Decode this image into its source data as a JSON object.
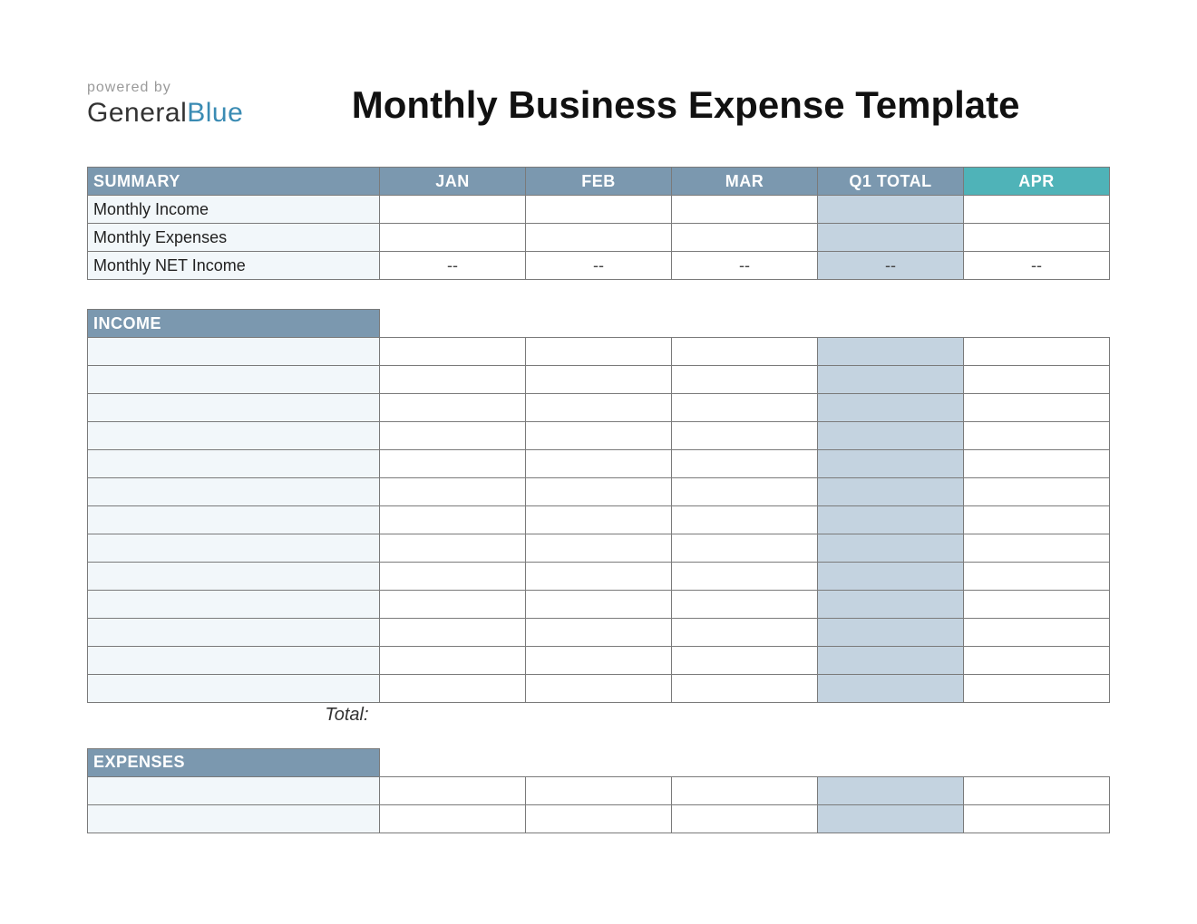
{
  "brand": {
    "powered": "powered by",
    "name1": "General",
    "name2": "Blue"
  },
  "title": "Monthly Business Expense Template",
  "columns": {
    "c0": "SUMMARY",
    "c1": "JAN",
    "c2": "FEB",
    "c3": "MAR",
    "c4": "Q1 TOTAL",
    "c5": "APR"
  },
  "summary": {
    "r0": {
      "label": "Monthly Income",
      "jan": "",
      "feb": "",
      "mar": "",
      "q1": "",
      "apr": ""
    },
    "r1": {
      "label": "Monthly Expenses",
      "jan": "",
      "feb": "",
      "mar": "",
      "q1": "",
      "apr": ""
    },
    "r2": {
      "label": "Monthly NET Income",
      "jan": "--",
      "feb": "--",
      "mar": "--",
      "q1": "--",
      "apr": "--"
    }
  },
  "income": {
    "header": "INCOME",
    "total_label": "Total:",
    "rows": [
      {
        "label": "",
        "jan": "",
        "feb": "",
        "mar": "",
        "q1": "",
        "apr": ""
      },
      {
        "label": "",
        "jan": "",
        "feb": "",
        "mar": "",
        "q1": "",
        "apr": ""
      },
      {
        "label": "",
        "jan": "",
        "feb": "",
        "mar": "",
        "q1": "",
        "apr": ""
      },
      {
        "label": "",
        "jan": "",
        "feb": "",
        "mar": "",
        "q1": "",
        "apr": ""
      },
      {
        "label": "",
        "jan": "",
        "feb": "",
        "mar": "",
        "q1": "",
        "apr": ""
      },
      {
        "label": "",
        "jan": "",
        "feb": "",
        "mar": "",
        "q1": "",
        "apr": ""
      },
      {
        "label": "",
        "jan": "",
        "feb": "",
        "mar": "",
        "q1": "",
        "apr": ""
      },
      {
        "label": "",
        "jan": "",
        "feb": "",
        "mar": "",
        "q1": "",
        "apr": ""
      },
      {
        "label": "",
        "jan": "",
        "feb": "",
        "mar": "",
        "q1": "",
        "apr": ""
      },
      {
        "label": "",
        "jan": "",
        "feb": "",
        "mar": "",
        "q1": "",
        "apr": ""
      },
      {
        "label": "",
        "jan": "",
        "feb": "",
        "mar": "",
        "q1": "",
        "apr": ""
      },
      {
        "label": "",
        "jan": "",
        "feb": "",
        "mar": "",
        "q1": "",
        "apr": ""
      },
      {
        "label": "",
        "jan": "",
        "feb": "",
        "mar": "",
        "q1": "",
        "apr": ""
      }
    ]
  },
  "expenses": {
    "header": "EXPENSES",
    "rows": [
      {
        "label": "",
        "jan": "",
        "feb": "",
        "mar": "",
        "q1": "",
        "apr": ""
      },
      {
        "label": "",
        "jan": "",
        "feb": "",
        "mar": "",
        "q1": "",
        "apr": ""
      }
    ]
  }
}
